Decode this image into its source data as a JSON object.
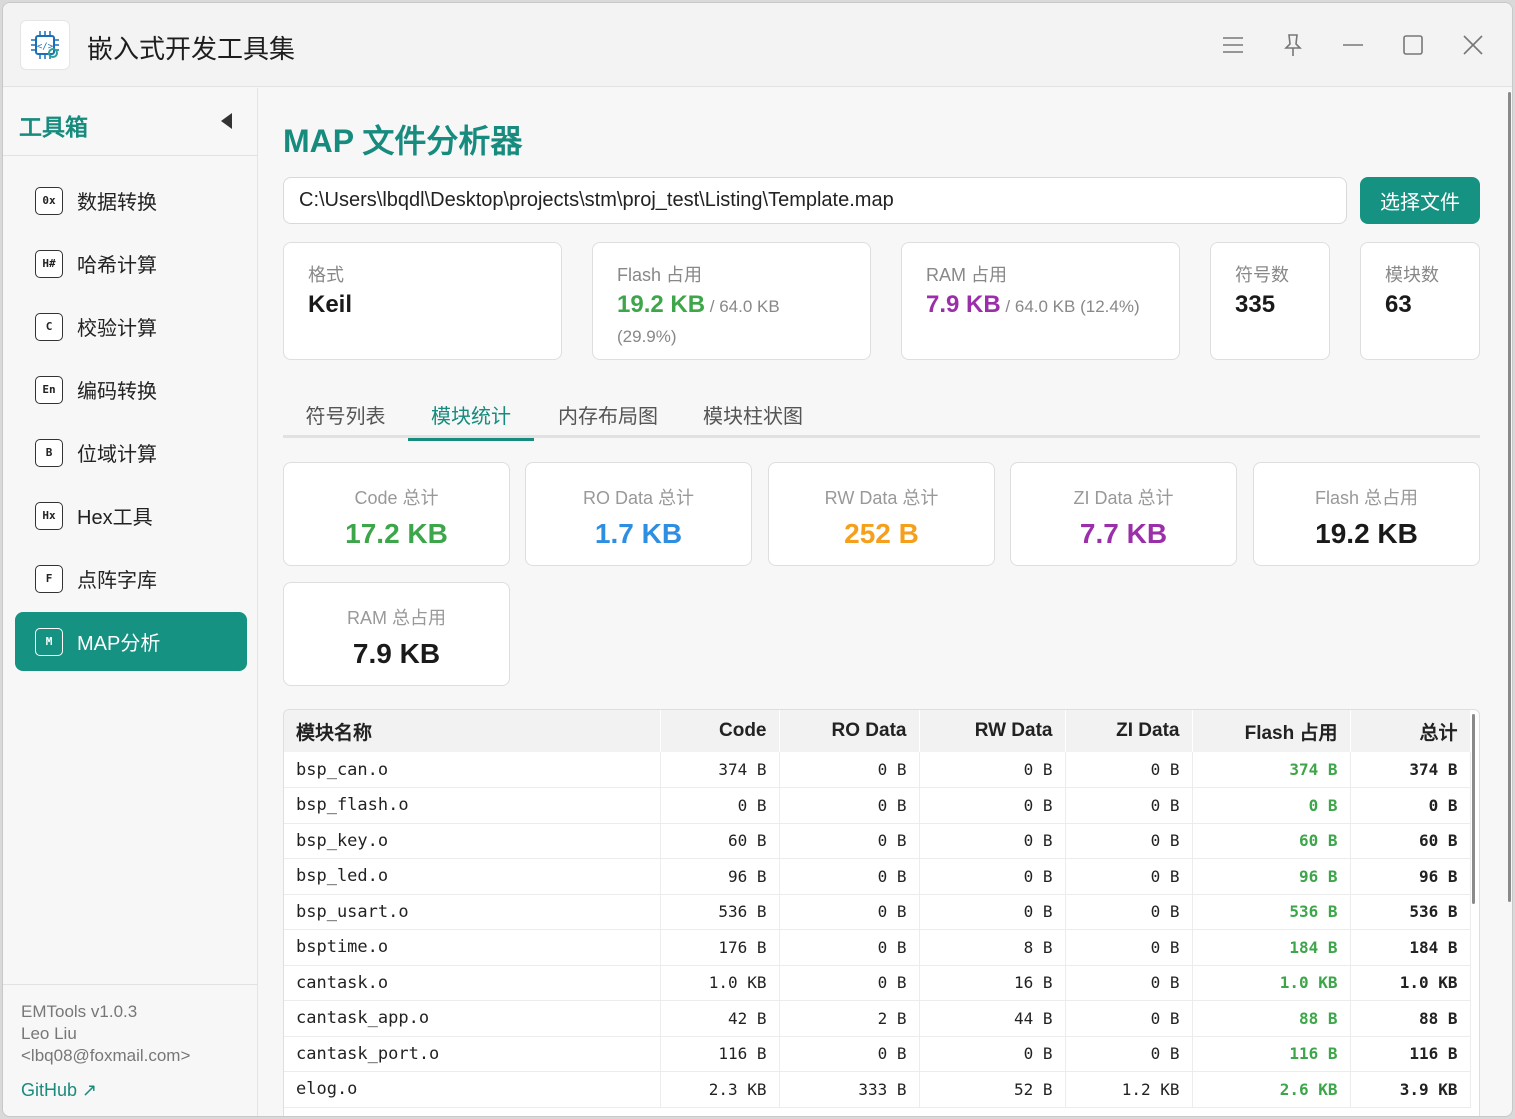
{
  "window": {
    "title": "嵌入式开发工具集"
  },
  "sidebar": {
    "title": "工具箱",
    "items": [
      {
        "badge": "0x",
        "label": "数据转换"
      },
      {
        "badge": "H#",
        "label": "哈希计算"
      },
      {
        "badge": "C",
        "label": "校验计算"
      },
      {
        "badge": "En",
        "label": "编码转换"
      },
      {
        "badge": "B",
        "label": "位域计算"
      },
      {
        "badge": "Hx",
        "label": "Hex工具"
      },
      {
        "badge": "F",
        "label": "点阵字库"
      },
      {
        "badge": "M",
        "label": "MAP分析"
      }
    ],
    "footer": {
      "version": "EMTools v1.0.3",
      "author": "Leo Liu",
      "email": "<lbq08@foxmail.com>",
      "github": "GitHub ↗"
    }
  },
  "main": {
    "title": "MAP 文件分析器",
    "path": "C:\\Users\\lbqdl\\Desktop\\projects\\stm\\proj_test\\Listing\\Template.map",
    "choose_button": "选择文件",
    "info": {
      "format_label": "格式",
      "format_value": "Keil",
      "flash_label": "Flash 占用",
      "flash_value": "19.2 KB",
      "flash_total": " / 64.0 KB",
      "flash_pct": "(29.9%)",
      "ram_label": "RAM 占用",
      "ram_value": "7.9 KB",
      "ram_total": " / 64.0 KB (12.4%)",
      "symbols_label": "符号数",
      "symbols_value": "335",
      "modules_label": "模块数",
      "modules_value": "63"
    },
    "tabs": [
      "符号列表",
      "模块统计",
      "内存布局图",
      "模块柱状图"
    ],
    "active_tab": "模块统计",
    "stats": {
      "code_label": "Code 总计",
      "code_value": "17.2 KB",
      "ro_label": "RO Data 总计",
      "ro_value": "1.7 KB",
      "rw_label": "RW Data 总计",
      "rw_value": "252 B",
      "zi_label": "ZI Data 总计",
      "zi_value": "7.7 KB",
      "flash_label": "Flash 总占用",
      "flash_value": "19.2 KB",
      "ram_label": "RAM 总占用",
      "ram_value": "7.9 KB"
    },
    "table": {
      "headers": [
        "模块名称",
        "Code",
        "RO Data",
        "RW Data",
        "ZI Data",
        "Flash 占用",
        "总计"
      ],
      "rows": [
        [
          "bsp_can.o",
          "374 B",
          "0 B",
          "0 B",
          "0 B",
          "374 B",
          "374 B"
        ],
        [
          "bsp_flash.o",
          "0 B",
          "0 B",
          "0 B",
          "0 B",
          "0 B",
          "0 B"
        ],
        [
          "bsp_key.o",
          "60 B",
          "0 B",
          "0 B",
          "0 B",
          "60 B",
          "60 B"
        ],
        [
          "bsp_led.o",
          "96 B",
          "0 B",
          "0 B",
          "0 B",
          "96 B",
          "96 B"
        ],
        [
          "bsp_usart.o",
          "536 B",
          "0 B",
          "0 B",
          "0 B",
          "536 B",
          "536 B"
        ],
        [
          "bsptime.o",
          "176 B",
          "0 B",
          "8 B",
          "0 B",
          "184 B",
          "184 B"
        ],
        [
          "cantask.o",
          "1.0 KB",
          "0 B",
          "16 B",
          "0 B",
          "1.0 KB",
          "1.0 KB"
        ],
        [
          "cantask_app.o",
          "42 B",
          "2 B",
          "44 B",
          "0 B",
          "88 B",
          "88 B"
        ],
        [
          "cantask_port.o",
          "116 B",
          "0 B",
          "0 B",
          "0 B",
          "116 B",
          "116 B"
        ],
        [
          "elog.o",
          "2.3 KB",
          "333 B",
          "52 B",
          "1.2 KB",
          "2.6 KB",
          "3.9 KB"
        ]
      ]
    }
  },
  "colors": {
    "accent": "#169282",
    "green": "#3ea64a",
    "purple": "#9b2faa",
    "blue": "#2d8ee2",
    "orange": "#f5a01c"
  }
}
